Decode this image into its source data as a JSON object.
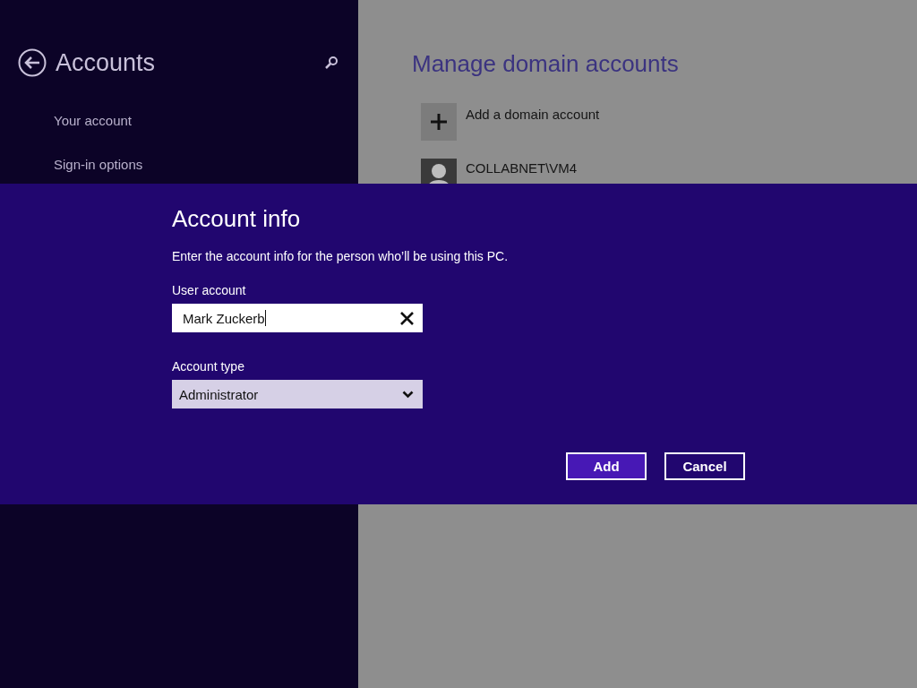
{
  "sidebar": {
    "title": "Accounts",
    "items": [
      {
        "label": "Your account"
      },
      {
        "label": "Sign-in options"
      }
    ]
  },
  "content": {
    "title": "Manage domain accounts",
    "items": [
      {
        "kind": "add",
        "label": "Add a domain account"
      },
      {
        "kind": "account",
        "name": "COLLABNET\\VM4"
      }
    ]
  },
  "dialog": {
    "title": "Account info",
    "description": "Enter the account info for the person who’ll be using this PC.",
    "user_label": "User account",
    "user_value": "Mark Zuckerb",
    "type_label": "Account type",
    "type_value": "Administrator",
    "buttons": [
      {
        "label": "Add",
        "kind": "primary"
      },
      {
        "label": "Cancel",
        "kind": "secondary"
      }
    ]
  }
}
